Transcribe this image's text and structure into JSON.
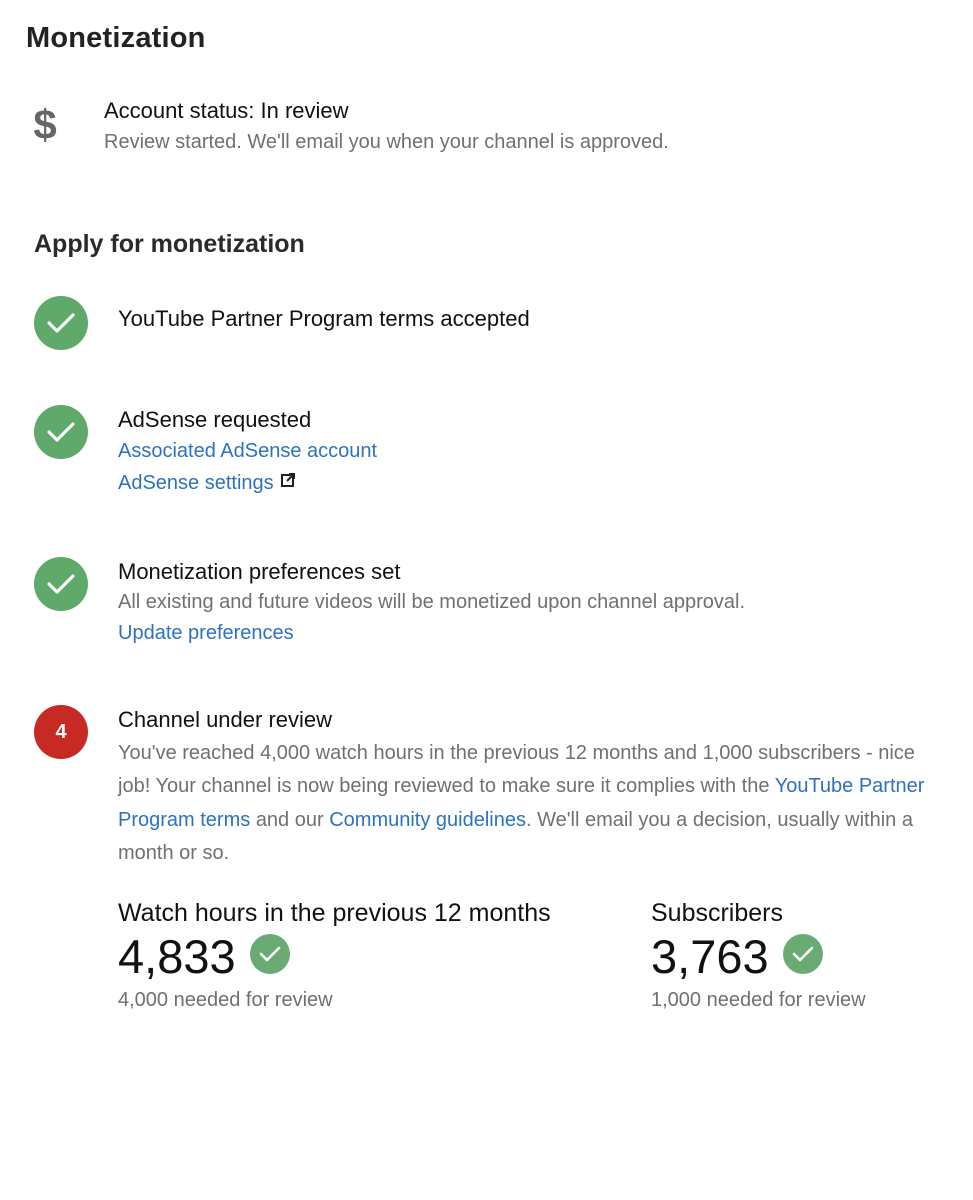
{
  "page": {
    "title": "Monetization"
  },
  "account_status": {
    "icon": "dollar-icon",
    "title": "Account status: In review",
    "description": "Review started. We'll email you when your channel is approved."
  },
  "apply": {
    "heading": "Apply for monetization",
    "steps": [
      {
        "state": "done",
        "icon": "check-icon",
        "title": "YouTube Partner Program terms accepted"
      },
      {
        "state": "done",
        "icon": "check-icon",
        "title": "AdSense requested",
        "links": [
          "Associated AdSense account",
          "AdSense settings"
        ],
        "external_icon": "external-link-icon"
      },
      {
        "state": "done",
        "icon": "check-icon",
        "title": "Monetization preferences set",
        "text": "All existing and future videos will be monetized upon channel approval.",
        "link": "Update preferences"
      },
      {
        "state": "pending",
        "number": "4",
        "title": "Channel under review",
        "para_1": "You've reached 4,000 watch hours in the previous 12 months and 1,000 subscribers - nice job! Your channel is now being reviewed to make sure it complies with the",
        "para_link_1": "YouTube Partner Program terms",
        "para_2": "and our",
        "para_link_2": "Community guidelines",
        "para_3": ". We'll email you a decision, usually within a month or so."
      }
    ]
  },
  "stats": {
    "watch_hours": {
      "label": "Watch hours in the previous 12 months",
      "value": "4,833",
      "note": "4,000 needed for review",
      "icon": "check-icon"
    },
    "subscribers": {
      "label": "Subscribers",
      "value": "3,763",
      "note": "1,000 needed for review",
      "icon": "check-icon"
    }
  },
  "colors": {
    "done_green": "#5fa96a",
    "pending_red": "#c62a23",
    "link_blue": "#2d72c2",
    "secondary_text": "#707070"
  }
}
